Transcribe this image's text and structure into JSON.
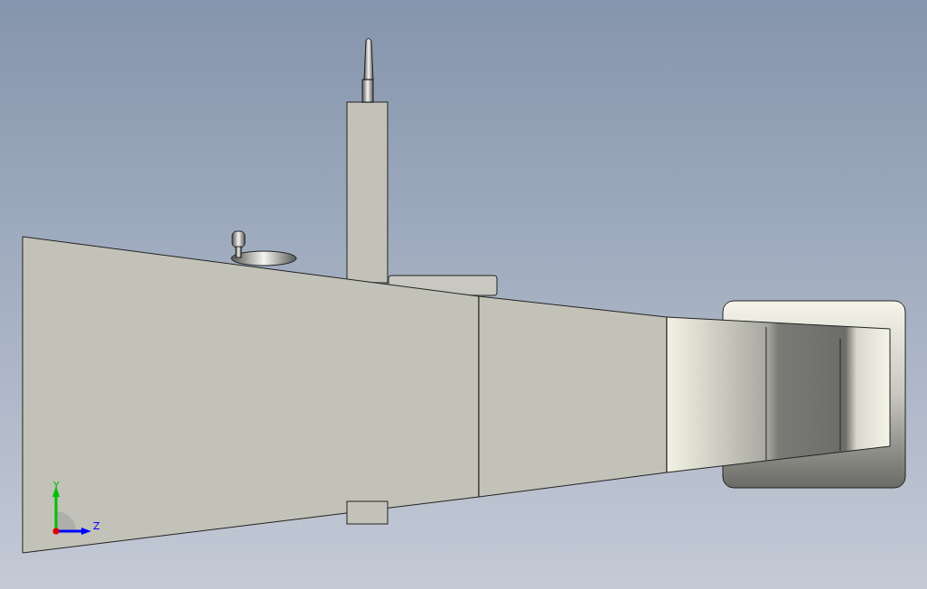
{
  "view_triad": {
    "axes": [
      {
        "label": "Y",
        "color": "#00c000",
        "kind": "vertical"
      },
      {
        "label": "Z",
        "color": "#0000ff",
        "kind": "horizontal"
      }
    ]
  }
}
